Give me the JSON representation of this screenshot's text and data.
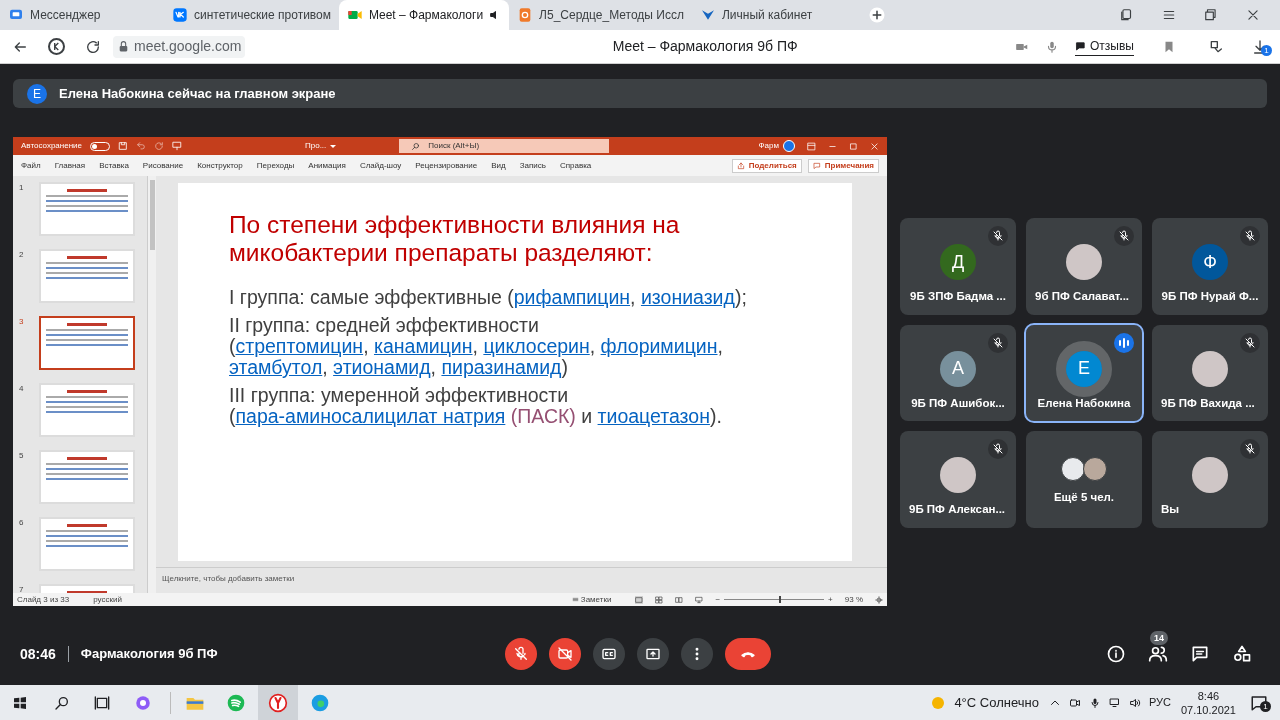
{
  "browser": {
    "tabs": [
      {
        "title": "Мессенджер",
        "selected": false,
        "kind": "messenger"
      },
      {
        "title": "синтетические противом",
        "selected": false,
        "kind": "vk"
      },
      {
        "title": "Meet – Фармакологи",
        "selected": true,
        "kind": "meet"
      },
      {
        "title": "Л5_Сердце_Методы Иссл",
        "selected": false,
        "kind": "doc"
      },
      {
        "title": "Личный кабинет",
        "selected": false,
        "kind": "cabinet"
      }
    ],
    "address": "meet.google.com",
    "page_title": "Meet – Фармакология 9б ПФ",
    "feedback": "Отзывы",
    "downloads_badge": "1"
  },
  "banner": {
    "avatar_letter": "Е",
    "text": "Елена Набокина сейчас на главном экране"
  },
  "powerpoint": {
    "autosave_label": "Автосохранение",
    "autosave_on": false,
    "file_name": "Про...",
    "search_placeholder": "Поиск (Alt+Ы)",
    "user_name": "Фарм",
    "menu": [
      "Файл",
      "Главная",
      "Вставка",
      "Рисование",
      "Конструктор",
      "Переходы",
      "Анимация",
      "Слайд-шоу",
      "Рецензирование",
      "Вид",
      "Запись",
      "Справка"
    ],
    "share": "Поделиться",
    "comments": "Примечания",
    "thumbnails": [
      {
        "number": "1",
        "selected": false
      },
      {
        "number": "2",
        "selected": false
      },
      {
        "number": "3",
        "selected": true
      },
      {
        "number": "4",
        "selected": false
      },
      {
        "number": "5",
        "selected": false
      },
      {
        "number": "6",
        "selected": false
      },
      {
        "number": "7",
        "selected": false
      }
    ],
    "slide": {
      "title": "По степени эффективности влияния на микобактерии препараты разделяют:",
      "paragraphs": [
        [
          [
            {
              "kind": "plain",
              "text": "I группа: самые эффективные ("
            },
            {
              "kind": "link",
              "text": "рифампицин"
            },
            {
              "kind": "plain",
              "text": ", "
            },
            {
              "kind": "link",
              "text": "изониазид"
            },
            {
              "kind": "plain",
              "text": ");"
            }
          ]
        ],
        [
          [
            {
              "kind": "plain",
              "text": "II группа: средней эффективности"
            }
          ],
          [
            {
              "kind": "plain",
              "text": "("
            },
            {
              "kind": "link",
              "text": "стрептомицин"
            },
            {
              "kind": "plain",
              "text": ", "
            },
            {
              "kind": "link",
              "text": "канамицин"
            },
            {
              "kind": "plain",
              "text": ", "
            },
            {
              "kind": "link",
              "text": "циклосерин"
            },
            {
              "kind": "plain",
              "text": ", "
            },
            {
              "kind": "link",
              "text": "флоримицин"
            },
            {
              "kind": "plain",
              "text": ", "
            },
            {
              "kind": "link",
              "text": "этамбутол"
            },
            {
              "kind": "plain",
              "text": ", "
            },
            {
              "kind": "link",
              "text": "этионамид"
            },
            {
              "kind": "plain",
              "text": ", "
            },
            {
              "kind": "link",
              "text": "пиразинамид"
            },
            {
              "kind": "plain",
              "text": ")"
            }
          ]
        ],
        [
          [
            {
              "kind": "plain",
              "text": "III группа: умеренной эффективности ("
            },
            {
              "kind": "link",
              "text": "пара-аминосалицилат натрия"
            },
            {
              "kind": "visited",
              "text": "(ПАСК)"
            },
            {
              "kind": "plain",
              "text": " и "
            },
            {
              "kind": "link",
              "text": "тиоацетазон"
            },
            {
              "kind": "plain",
              "text": ")."
            }
          ]
        ]
      ]
    },
    "notes_placeholder": "Щелкните, чтобы добавить заметки",
    "status": {
      "slide_counter": "Слайд 3 из 33",
      "language": "русский",
      "notes_label": "Заметки",
      "zoom_out": "−",
      "level": 0.55,
      "zoom_in": "+",
      "zoom_reading": "93 %"
    }
  },
  "participants": [
    {
      "kind": "letter",
      "name": "9Б ЗПФ Бадма ...",
      "letter": "Д",
      "color": "#33691e",
      "muted": true,
      "speaking": false
    },
    {
      "kind": "photo",
      "name": "9б ПФ Салават...",
      "muted": true,
      "speaking": false
    },
    {
      "kind": "letter",
      "name": "9Б ПФ Нурай Ф...",
      "letter": "Ф",
      "color": "#01579b",
      "muted": true,
      "speaking": false
    },
    {
      "kind": "letter",
      "name": "9Б ПФ Ашибок...",
      "letter": "А",
      "color": "#78909c",
      "muted": true,
      "speaking": false
    },
    {
      "kind": "letter",
      "name": "Елена Набокина",
      "letter": "Е",
      "color": "#0288d1",
      "muted": false,
      "speaking": true
    },
    {
      "kind": "photo",
      "name": "9Б ПФ Вахида ...",
      "muted": true,
      "speaking": false
    },
    {
      "kind": "photo",
      "name": "9Б ПФ Алексан...",
      "muted": true,
      "speaking": false
    },
    {
      "kind": "more",
      "name": "Ещё 5 чел.",
      "muted": false,
      "speaking": false
    },
    {
      "kind": "photo",
      "name": "Вы",
      "muted": true,
      "speaking": false
    }
  ],
  "meeting_bar": {
    "time": "08:46",
    "title": "Фармакология 9б ПФ",
    "people_count": "14"
  },
  "taskbar": {
    "weather": "4°C Солнечно",
    "language": "РУС",
    "time": "8:46",
    "date": "07.10.2021",
    "notifications": "1"
  }
}
